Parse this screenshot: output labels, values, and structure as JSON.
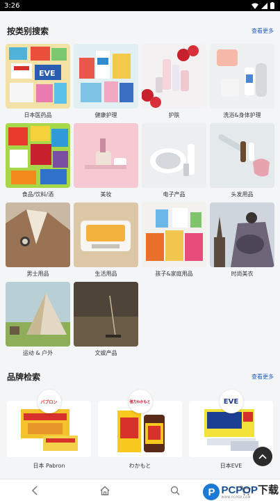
{
  "status_bar": {
    "time": "3:26"
  },
  "categories_section": {
    "title": "按类别搜索",
    "more": "查看更多",
    "items": [
      {
        "label": "日本医药品",
        "icon": "medicine"
      },
      {
        "label": "健康护理",
        "icon": "health-care"
      },
      {
        "label": "护肤",
        "icon": "skincare"
      },
      {
        "label": "洗浴&身体护理",
        "icon": "bath"
      },
      {
        "label": "食品/饮料/酒",
        "icon": "food"
      },
      {
        "label": "美妆",
        "icon": "makeup"
      },
      {
        "label": "电子产品",
        "icon": "electronics"
      },
      {
        "label": "头发用品",
        "icon": "hair"
      },
      {
        "label": "男士用品",
        "icon": "mens"
      },
      {
        "label": "生活用品",
        "icon": "living"
      },
      {
        "label": "孩子&家庭用品",
        "icon": "kids-family"
      },
      {
        "label": "时尚美衣",
        "icon": "fashion"
      },
      {
        "label": "运动 & 户外",
        "icon": "outdoor"
      },
      {
        "label": "文娱产品",
        "icon": "entertainment"
      }
    ]
  },
  "brands_section": {
    "title": "品牌检索",
    "more": "查看更多",
    "items": [
      {
        "name": "日本 Pabron",
        "logo_text": "パブロン",
        "logo_color": "#d22b2b"
      },
      {
        "name": "わかもと",
        "logo_text": "強力わかもと",
        "logo_color": "#c8102e"
      },
      {
        "name": "日本EVE",
        "logo_text": "EVE",
        "logo_color": "#1c3f94"
      }
    ]
  },
  "bottom_nav": {
    "items": [
      {
        "icon": "back-icon"
      },
      {
        "icon": "home-icon"
      },
      {
        "icon": "search-icon"
      },
      {
        "icon": "cart-icon"
      }
    ]
  },
  "watermark": {
    "logo": "P",
    "brand": "PCPOP",
    "suffix": "下载",
    "sub": "WWW.PCPOP.COM"
  },
  "colors": {
    "accent": "#1f5fbf",
    "background": "#f4f5f7"
  }
}
